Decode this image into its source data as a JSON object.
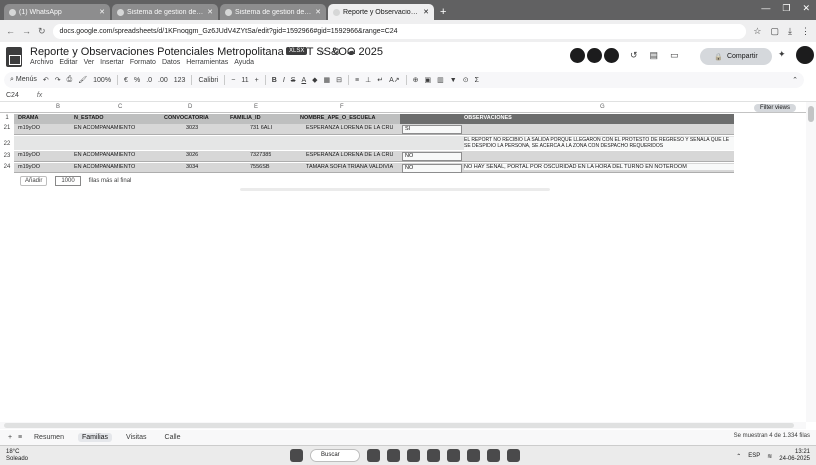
{
  "browser": {
    "tabs": [
      {
        "label": "(1) WhatsApp"
      },
      {
        "label": "Sistema de gestion de s..."
      },
      {
        "label": "Sistema de gestion de s..."
      },
      {
        "label": "Reporte y Observaciones Pot..."
      }
    ],
    "new_tab": "+",
    "window_controls": [
      "—",
      "❐",
      "✕"
    ],
    "url": "docs.google.com/spreadsheets/d/1KFnoqgm_Gz6JUdV4ZYtSa/edit?gid=1592966#gid=1592966&range=C24"
  },
  "sheet": {
    "title": "Reporte y Observaciones Potenciales Metropolitana AATT SS&OO 2025",
    "badge": "XLSX",
    "menus": [
      "Archivo",
      "Editar",
      "Ver",
      "Insertar",
      "Formato",
      "Datos",
      "Herramientas",
      "Ayuda"
    ],
    "share_label": "Compartir"
  },
  "toolbar": {
    "search": "Menús",
    "zoom": "100%",
    "font": "Calibri",
    "font_size": "11"
  },
  "formula_bar": {
    "cell_ref": "C24",
    "fx": "fx",
    "value": ""
  },
  "grid": {
    "column_letters": [
      "B",
      "C",
      "D",
      "E",
      "F",
      "G"
    ],
    "filter_views_label": "Filter views",
    "header_row": [
      "DRAMA",
      "N_ESTADO",
      "CONVOCATORIA",
      "FAMILIA_ID",
      "NOMBRE_APE_O_ESCUELA",
      "",
      "OBSERVACIONES"
    ],
    "rows": [
      {
        "num": "21",
        "cells": [
          "m19yOO",
          "EN ACOMPAÑAMIENTO",
          "3023",
          "731 6ALI",
          "ESPERANZA LORENA DE LA CRU",
          "SI",
          ""
        ]
      },
      {
        "num": "22",
        "cells": [
          "",
          "",
          "",
          "",
          "",
          "",
          "EL REPORT NO RECIBIO LA SALIDA PORQUE LLEGARON CON EL PROTESTO DE REGRESO Y SEÑALA QUE LE SE DESPIDIO LA PERSONA, SE ACERCA A LA ZONA CON DESPACHO REQUERIDOS"
        ]
      },
      {
        "num": "23",
        "cells": [
          "m19yOO",
          "EN ACOMPAÑAMIENTO",
          "3026",
          "7327385",
          "ESPERANZA LORENA DE LA CRU",
          "NO",
          ""
        ]
      },
      {
        "num": "24",
        "cells": [
          "m19yOO",
          "EN ACOMPAÑAMIENTO",
          "3034",
          "7556SB",
          "TAMARA SOFIA TRIANA VALDIVIA",
          "NO",
          "NO HAY SEÑAL, PORTAL POR OSCURIDAD EN LA HORA DEL TURNO EN NOTEROOM"
        ]
      }
    ],
    "add_row": {
      "add_label": "Añadir",
      "quantity": "1000",
      "suffix": "filas más al final"
    }
  },
  "sheet_tabs": {
    "tabs": [
      "Resumen",
      "Familias",
      "Visitas",
      "Calle"
    ],
    "active": "Familias",
    "status": "Se muestran 4 de 1.334 filas"
  },
  "taskbar": {
    "weather_temp": "18°C",
    "weather_desc": "Soleado",
    "search_label": "Buscar",
    "lang": "ESP",
    "time": "13:21",
    "date": "24-06-2025"
  }
}
